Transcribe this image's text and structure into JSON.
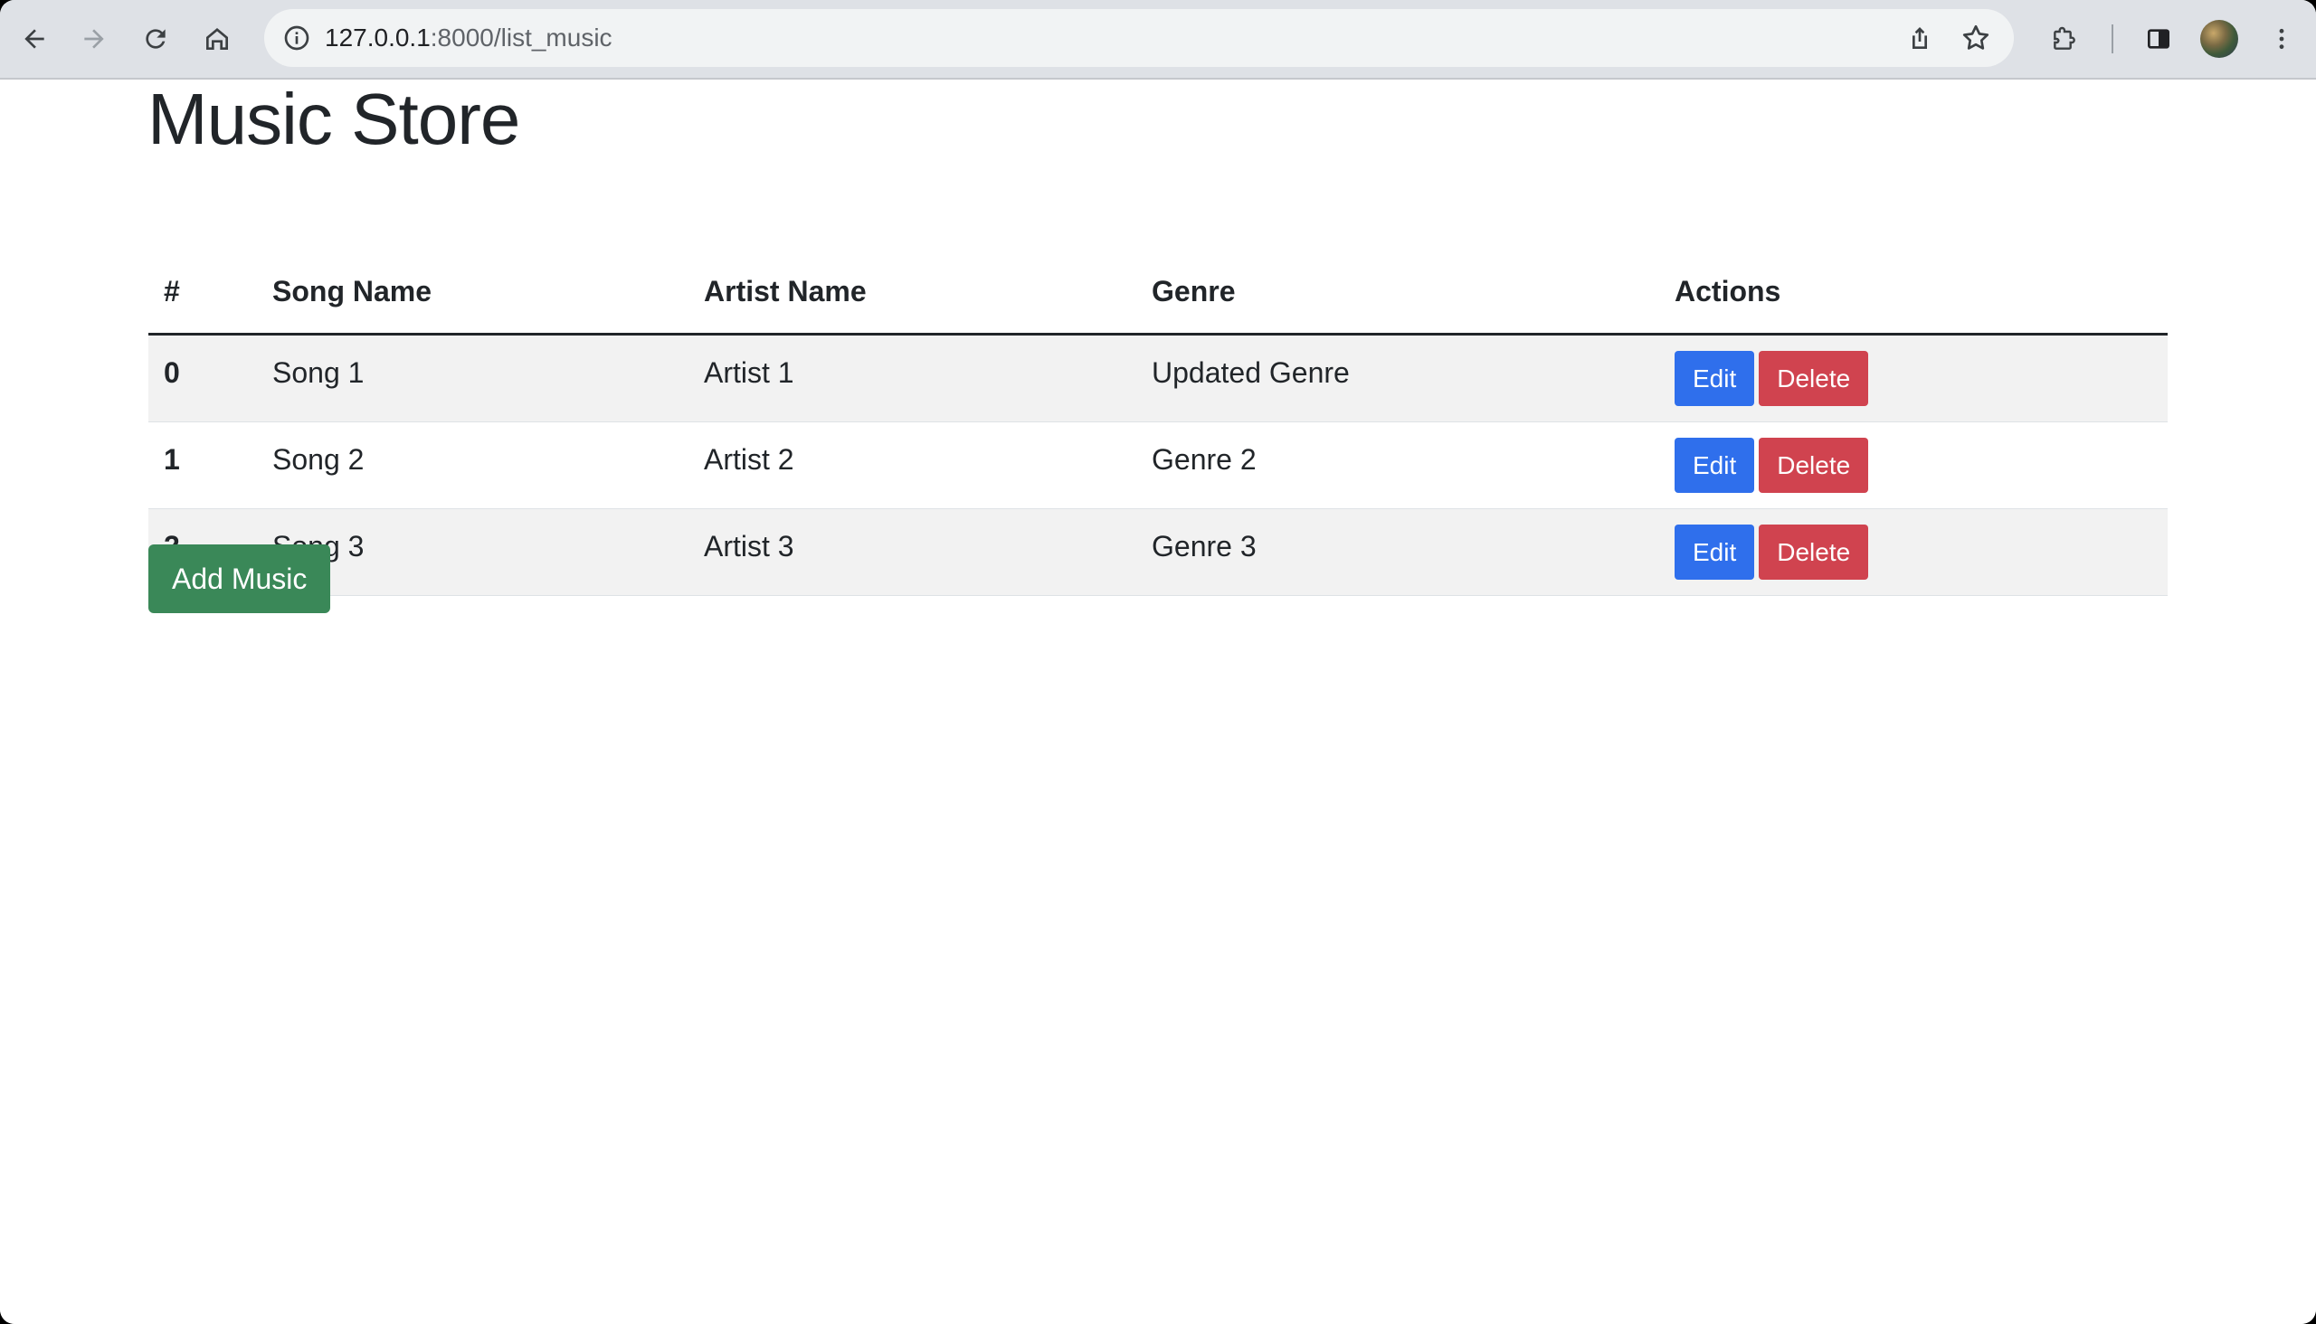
{
  "browser": {
    "url_host": "127.0.0.1",
    "url_rest": ":8000/list_music"
  },
  "page": {
    "title": "Music Store"
  },
  "table": {
    "headers": {
      "num": "#",
      "song": "Song Name",
      "artist": "Artist Name",
      "genre": "Genre",
      "actions": "Actions"
    },
    "rows": [
      {
        "num": "0",
        "song": "Song 1",
        "artist": "Artist 1",
        "genre": "Updated Genre",
        "edit": "Edit",
        "delete": "Delete"
      },
      {
        "num": "1",
        "song": "Song 2",
        "artist": "Artist 2",
        "genre": "Genre 2",
        "edit": "Edit",
        "delete": "Delete"
      },
      {
        "num": "2",
        "song": "Song 3",
        "artist": "Artist 3",
        "genre": "Genre 3",
        "edit": "Edit",
        "delete": "Delete"
      }
    ]
  },
  "actions": {
    "add_label": "Add Music"
  },
  "colors": {
    "edit_button": "#2f6fec",
    "delete_button": "#d0434f",
    "add_button": "#3a8858",
    "stripe": "#f2f2f2"
  },
  "icons": {
    "back": "back-arrow-icon",
    "forward": "forward-arrow-icon",
    "reload": "reload-icon",
    "home": "home-icon",
    "info": "info-icon",
    "share": "share-icon",
    "bookmark": "star-icon",
    "extensions": "puzzle-icon",
    "side_panel": "side-panel-icon",
    "menu": "kebab-menu-icon"
  }
}
